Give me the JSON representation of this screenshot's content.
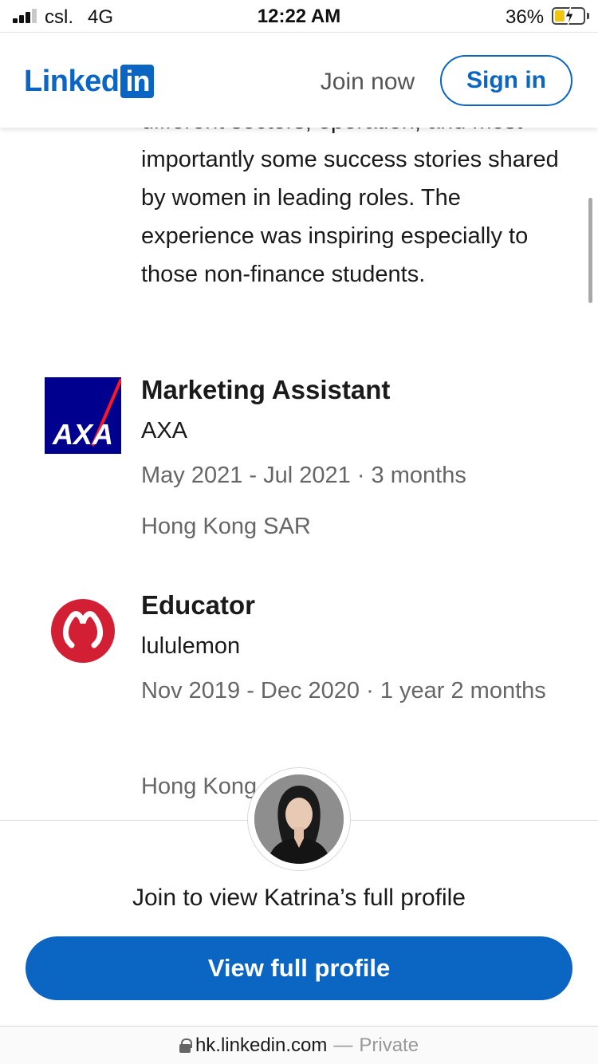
{
  "status_bar": {
    "carrier": "csl.",
    "network": "4G",
    "time": "12:22 AM",
    "battery_percent": "36%",
    "battery_level": 0.36
  },
  "header": {
    "logo_text": "Linked",
    "logo_badge": "in",
    "join_now": "Join now",
    "sign_in": "Sign in",
    "brand_color": "#0a66c2"
  },
  "description": {
    "text": "different sectors, operation, and most importantly some success stories shared by women in leading roles. The experience was inspiring especially to those non-finance students."
  },
  "experiences": [
    {
      "title": "Marketing Assistant",
      "company": "AXA",
      "logo_text": "AXA",
      "logo_color": "#00008f",
      "dates": "May 2021 - Jul 2021 · 3 months",
      "location": "Hong Kong SAR"
    },
    {
      "title": "Educator",
      "company": "lululemon",
      "logo_icon": "lululemon-logo-icon",
      "logo_color": "#d31f33",
      "dates": "Nov 2019 - Dec 2020 · 1 year 2 months",
      "location": "Hong Kong SAR"
    }
  ],
  "sheet": {
    "message": "Join to view Katrina’s full profile",
    "button": "View full profile"
  },
  "url_bar": {
    "domain": "hk.linkedin.com",
    "separator": "—",
    "mode": "Private"
  }
}
